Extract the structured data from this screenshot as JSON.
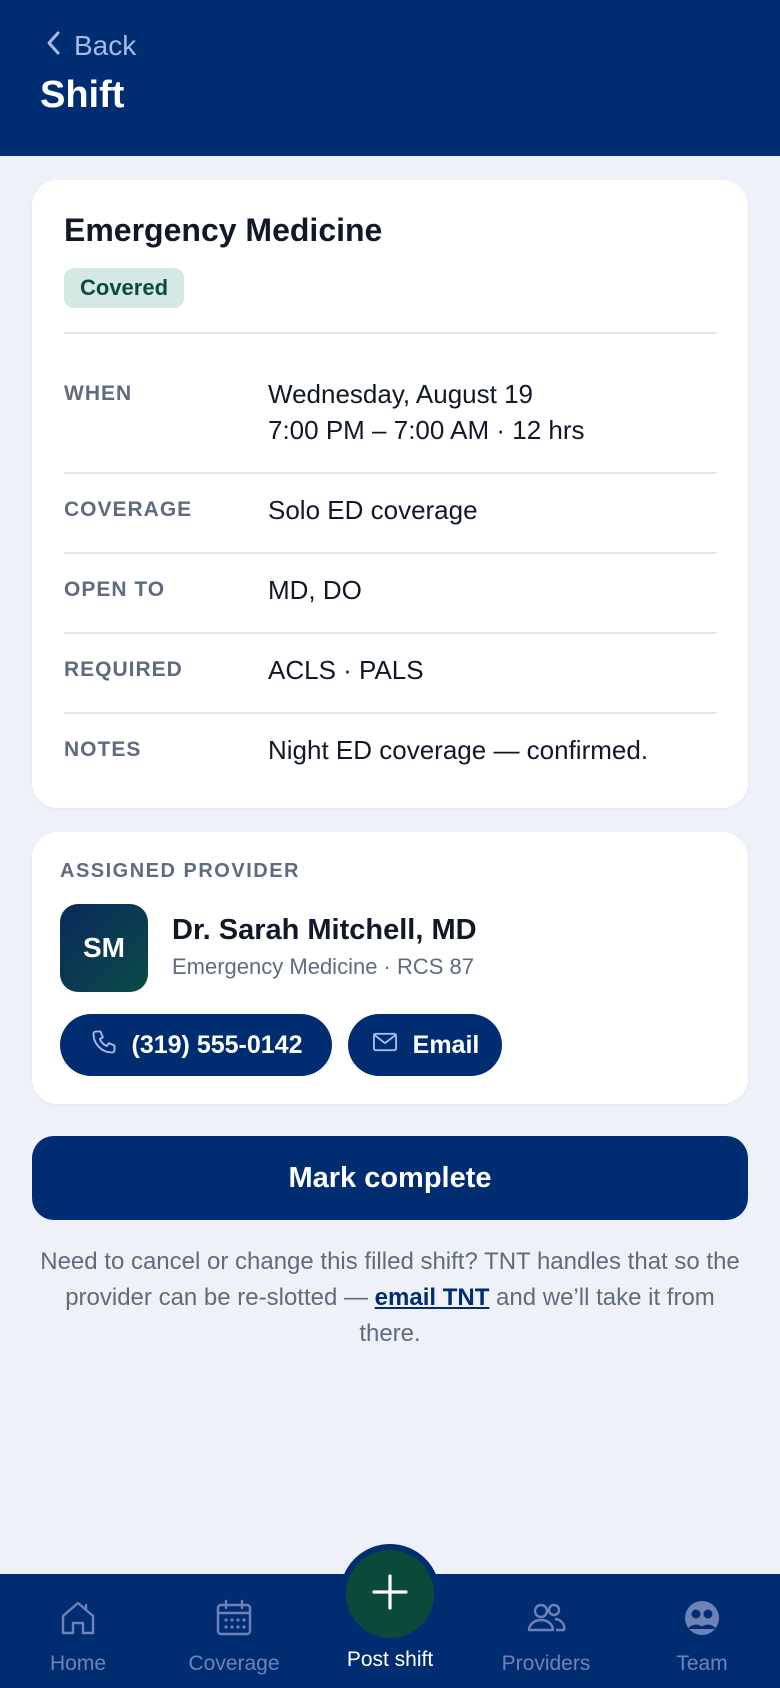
{
  "header": {
    "back_label": "Back",
    "title": "Shift"
  },
  "shift": {
    "title": "Emergency Medicine",
    "status": "Covered",
    "rows": [
      {
        "label": "WHEN",
        "value_line1": "Wednesday, August 19",
        "value_line2": "7:00 PM – 7:00 AM · 12 hrs"
      },
      {
        "label": "COVERAGE",
        "value": "Solo ED coverage"
      },
      {
        "label": "OPEN TO",
        "value": "MD, DO"
      },
      {
        "label": "REQUIRED",
        "value": "ACLS · PALS"
      },
      {
        "label": "NOTES",
        "value": "Night ED coverage — confirmed."
      }
    ]
  },
  "provider": {
    "section_label": "ASSIGNED PROVIDER",
    "initials": "SM",
    "name": "Dr. Sarah Mitchell, MD",
    "subtitle": "Emergency Medicine · RCS 87",
    "phone_label": "(319) 555-0142",
    "email_label": "Email"
  },
  "actions": {
    "mark_complete_label": "Mark complete"
  },
  "help": {
    "text_before": "Need to cancel or change this filled shift? TNT handles that so the provider can be re-slotted — ",
    "link_label": "email TNT",
    "text_after": " and we’ll take it from there."
  },
  "nav": {
    "items": [
      {
        "label": "Home",
        "icon": "home-icon"
      },
      {
        "label": "Coverage",
        "icon": "calendar-icon"
      },
      {
        "label": "Post shift",
        "icon": "plus-icon"
      },
      {
        "label": "Providers",
        "icon": "people-icon"
      },
      {
        "label": "Team",
        "icon": "team-icon"
      }
    ]
  },
  "colors": {
    "brand_navy": "#002d72",
    "fab_green": "#0b4a3a",
    "badge_bg": "#d6e8e3",
    "badge_text": "#0c4a3e",
    "page_bg": "#eef2f8"
  }
}
